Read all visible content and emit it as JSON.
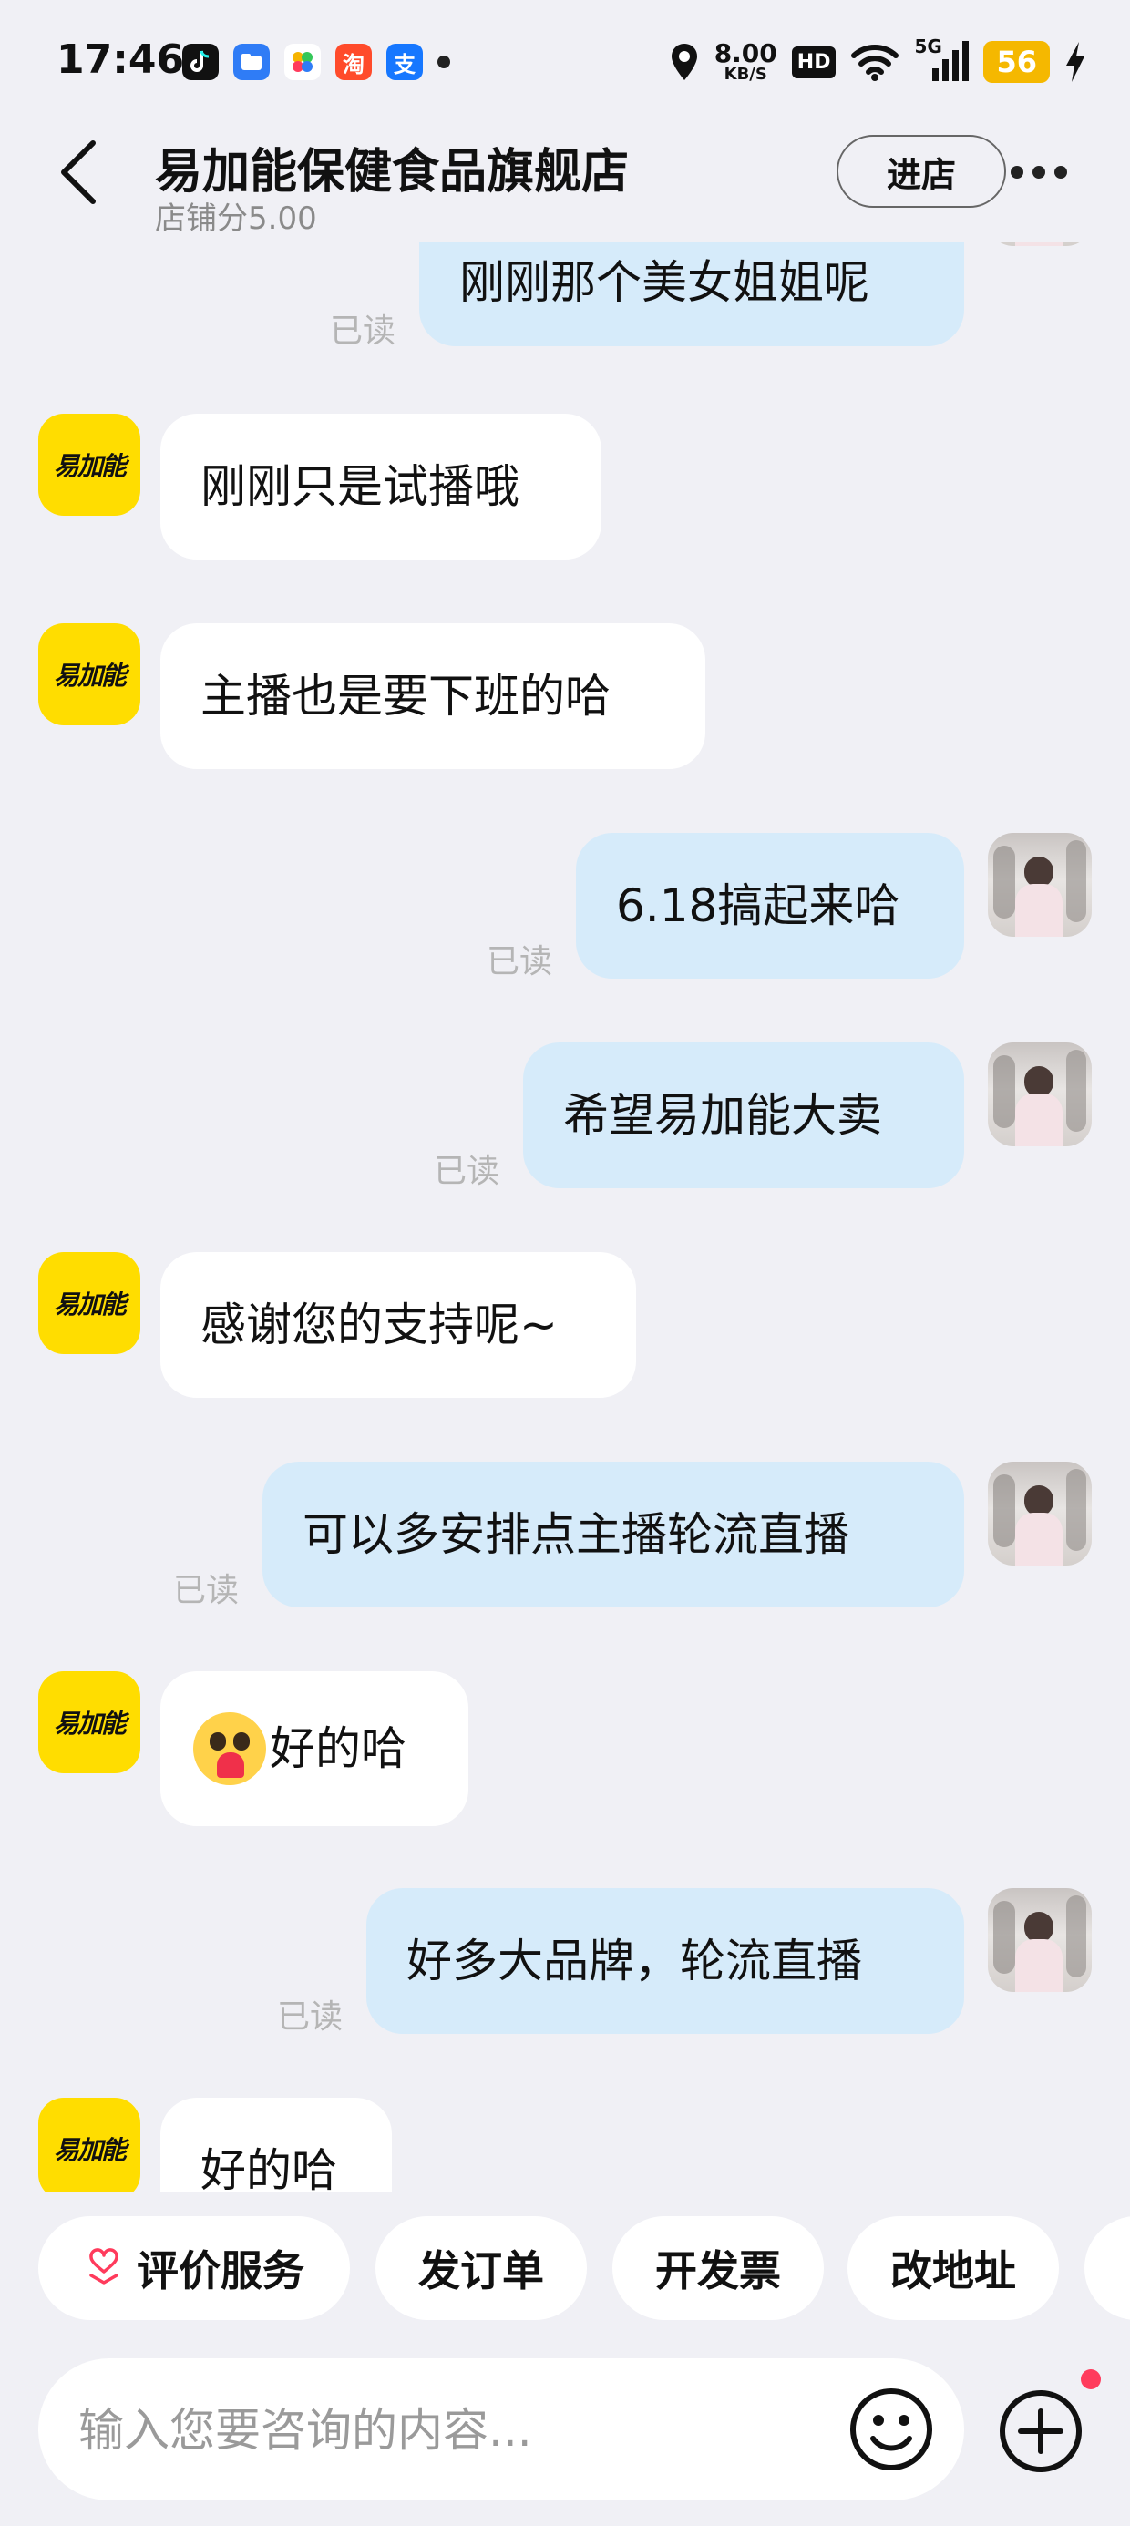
{
  "status_bar": {
    "time": "17:46",
    "app_icons": [
      "tiktok-icon",
      "files-icon",
      "photos-icon",
      "taobao-icon",
      "alipay-icon"
    ],
    "taobao_glyph": "淘",
    "alipay_glyph": "支",
    "net_speed_value": "8.00",
    "net_speed_unit": "KB/S",
    "hd_label": "HD",
    "network_label": "5G",
    "battery": "56"
  },
  "header": {
    "title": "易加能保健食品旗舰店",
    "subtitle": "店铺分5.00",
    "visit_button": "进店"
  },
  "shop_avatar_text": "易加能",
  "messages": [
    {
      "side": "out",
      "text": "刚刚那个美女姐姐呢",
      "read": "已读"
    },
    {
      "side": "in",
      "text": "刚刚只是试播哦"
    },
    {
      "side": "in",
      "text": "主播也是要下班的哈"
    },
    {
      "side": "out",
      "text": "6.18搞起来哈",
      "read": "已读"
    },
    {
      "side": "out",
      "text": "希望易加能大卖",
      "read": "已读"
    },
    {
      "side": "in",
      "text": "感谢您的支持呢~"
    },
    {
      "side": "out",
      "text": "可以多安排点主播轮流直播",
      "read": "已读"
    },
    {
      "side": "in",
      "text": "好的哈",
      "emoji": "heart-eyes-emoji"
    },
    {
      "side": "out",
      "text": "好多大品牌，轮流直播",
      "read": "已读"
    },
    {
      "side": "in",
      "text": "好的哈"
    }
  ],
  "quick_actions": [
    {
      "label": "评价服务",
      "icon": "heart-hand-icon"
    },
    {
      "label": "发订单"
    },
    {
      "label": "开发票"
    },
    {
      "label": "改地址"
    }
  ],
  "input": {
    "placeholder": "输入您要咨询的内容...",
    "value": ""
  },
  "colors": {
    "background": "#f0f0f5",
    "incoming_bubble": "#ffffff",
    "outgoing_bubble": "#d6ebfa",
    "brand_yellow": "#ffdd00",
    "badge_red": "#ff3b5c"
  }
}
